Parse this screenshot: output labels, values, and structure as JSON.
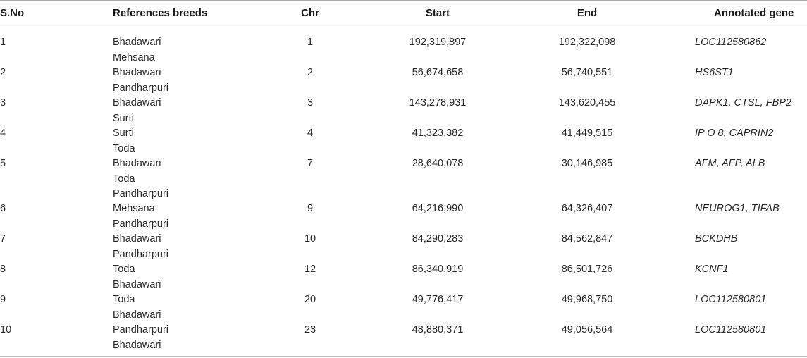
{
  "table": {
    "headers": {
      "sno": "S.No",
      "breeds": "References breeds",
      "chr": "Chr",
      "start": "Start",
      "end": "End",
      "gene": "Annotated gene"
    },
    "rows": [
      {
        "sno": "1",
        "breeds": [
          "Bhadawari",
          "Mehsana"
        ],
        "chr": "1",
        "start": "192,319,897",
        "end": "192,322,098",
        "gene": "LOC112580862"
      },
      {
        "sno": "2",
        "breeds": [
          "Bhadawari",
          "Pandharpuri"
        ],
        "chr": "2",
        "start": "56,674,658",
        "end": "56,740,551",
        "gene": "HS6ST1"
      },
      {
        "sno": "3",
        "breeds": [
          "Bhadawari",
          "Surti"
        ],
        "chr": "3",
        "start": "143,278,931",
        "end": "143,620,455",
        "gene": "DAPK1, CTSL, FBP2"
      },
      {
        "sno": "4",
        "breeds": [
          "Surti",
          "Toda"
        ],
        "chr": "4",
        "start": "41,323,382",
        "end": "41,449,515",
        "gene": "IP O 8, CAPRIN2"
      },
      {
        "sno": "5",
        "breeds": [
          "Bhadawari",
          "Toda",
          "Pandharpuri"
        ],
        "chr": "7",
        "start": "28,640,078",
        "end": "30,146,985",
        "gene": "AFM, AFP, ALB"
      },
      {
        "sno": "6",
        "breeds": [
          "Mehsana",
          "Pandharpuri"
        ],
        "chr": "9",
        "start": "64,216,990",
        "end": "64,326,407",
        "gene": "NEUROG1, TIFAB"
      },
      {
        "sno": "7",
        "breeds": [
          "Bhadawari",
          "Pandharpuri"
        ],
        "chr": "10",
        "start": "84,290,283",
        "end": "84,562,847",
        "gene": "BCKDHB"
      },
      {
        "sno": "8",
        "breeds": [
          "Toda",
          "Bhadawari"
        ],
        "chr": "12",
        "start": "86,340,919",
        "end": "86,501,726",
        "gene": "KCNF1"
      },
      {
        "sno": "9",
        "breeds": [
          "Toda",
          "Bhadawari"
        ],
        "chr": "20",
        "start": "49,776,417",
        "end": "49,968,750",
        "gene": "LOC112580801"
      },
      {
        "sno": "10",
        "breeds": [
          "Pandharpuri",
          "Bhadawari"
        ],
        "chr": "23",
        "start": "48,880,371",
        "end": "49,056,564",
        "gene": "LOC112580801"
      }
    ]
  }
}
